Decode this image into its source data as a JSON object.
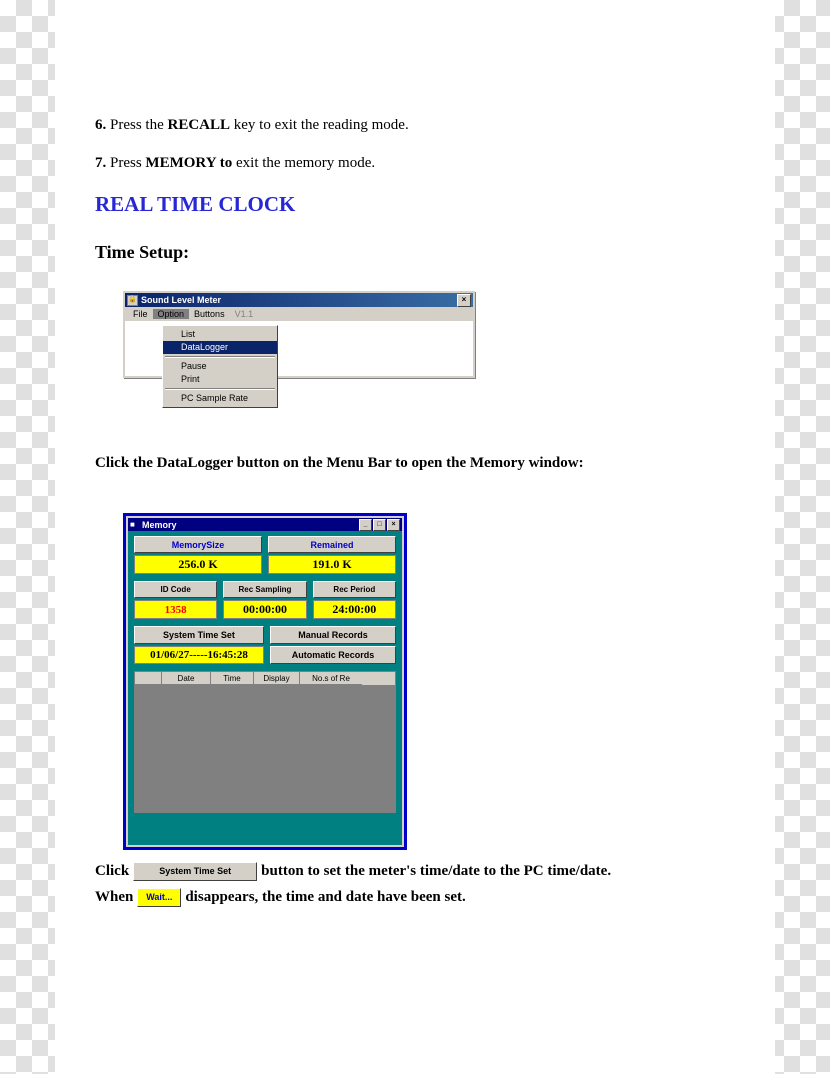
{
  "document": {
    "step6": {
      "num": "6.",
      "pre": " Press the ",
      "bold": "RECALL",
      "post": " key to exit the reading mode."
    },
    "step7": {
      "num": "7.",
      "pre": " Press ",
      "bold": "MEMORY to",
      "post": " exit the memory mode."
    },
    "heading": "REAL TIME CLOCK",
    "subheading": "Time Setup:",
    "caption": "Click the DataLogger button on the Menu Bar to open the Memory window:",
    "bottom_line1_a": "Click",
    "bottom_line1_b": "button to set the meter's time/date to the PC time/date.",
    "bottom_line2_a": "When",
    "bottom_line2_b": "disappears, the time and date have been set.",
    "inline_button_label": "System Time Set",
    "inline_wait_label": "Wait..."
  },
  "slm_window": {
    "title": "Sound Level Meter",
    "close_label": "×",
    "icon": "lock-icon",
    "menu": [
      {
        "label": "File",
        "state": "normal"
      },
      {
        "label": "Option",
        "state": "selected"
      },
      {
        "label": "Buttons",
        "state": "normal"
      },
      {
        "label": "V1.1",
        "state": "disabled"
      }
    ],
    "dropdown": [
      {
        "label": "List",
        "active": false
      },
      {
        "label": "DataLogger",
        "active": true
      },
      {
        "separator": true
      },
      {
        "label": "Pause",
        "active": false
      },
      {
        "label": "Print",
        "active": false
      },
      {
        "separator": true
      },
      {
        "label": "PC Sample Rate",
        "active": false
      }
    ]
  },
  "memory_window": {
    "title": "Memory",
    "icon": "memory-icon",
    "buttons": {
      "minimize": "_",
      "maximize": "□",
      "close": "×"
    },
    "row1": {
      "left_label": "MemorySize",
      "right_label": "Remained"
    },
    "row2": {
      "left_value": "256.0 K",
      "right_value": "191.0 K"
    },
    "row3": {
      "label1": "ID Code",
      "label2": "Rec Sampling",
      "label3": "Rec Period"
    },
    "row4": {
      "value1": "1358",
      "value2": "00:00:00",
      "value3": "24:00:00"
    },
    "row5": {
      "system_time_set": "System Time Set",
      "manual_records": "Manual Records"
    },
    "row6": {
      "datetime": "01/06/27-----16:45:28",
      "automatic_records": "Automatic Records"
    },
    "table_headers": [
      "",
      "Date",
      "Time",
      "Display",
      "No.s of Re"
    ]
  }
}
